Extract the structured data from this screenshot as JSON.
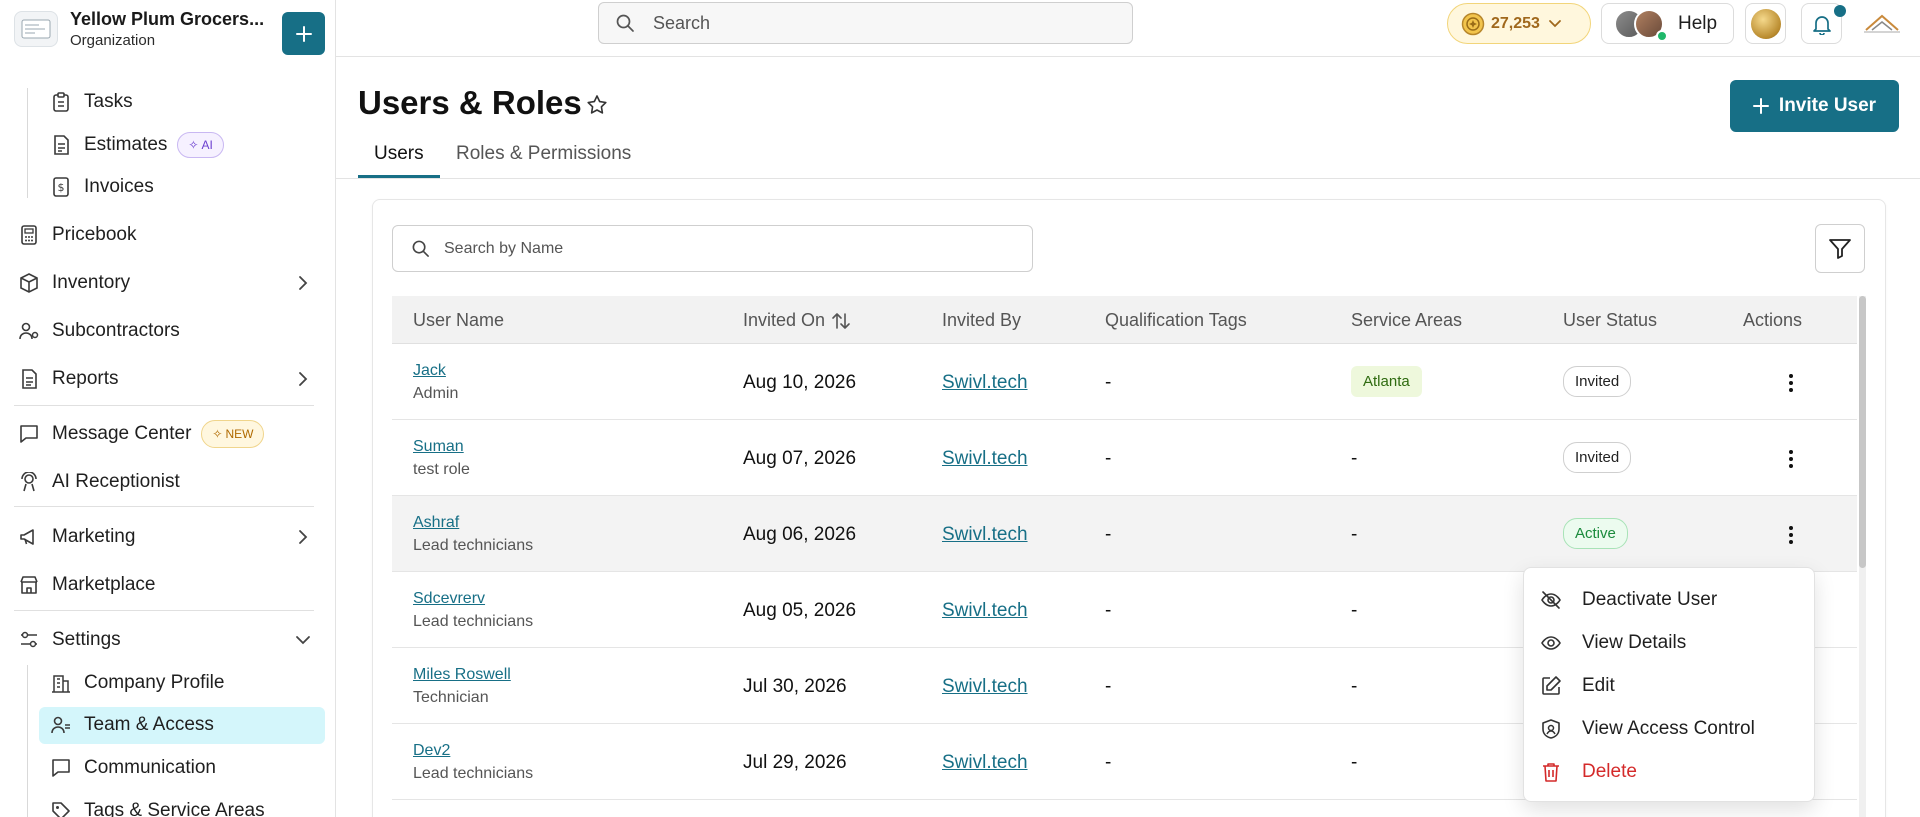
{
  "org": {
    "name": "Yellow Plum Grocers...",
    "type": "Organization"
  },
  "sidebar": {
    "project_items": [
      {
        "label": "Tasks",
        "icon": "clipboard-icon"
      },
      {
        "label": "Estimates",
        "icon": "estimate-icon",
        "badge": "AI"
      },
      {
        "label": "Invoices",
        "icon": "invoice-icon"
      }
    ],
    "items": [
      {
        "label": "Pricebook",
        "icon": "calculator-icon"
      },
      {
        "label": "Inventory",
        "icon": "box-icon",
        "expandable": true
      },
      {
        "label": "Subcontractors",
        "icon": "user-link-icon"
      },
      {
        "label": "Reports",
        "icon": "report-icon",
        "expandable": true
      },
      {
        "label": "Message Center",
        "icon": "message-icon",
        "badge": "NEW"
      },
      {
        "label": "AI Receptionist",
        "icon": "receptionist-icon"
      },
      {
        "label": "Marketing",
        "icon": "megaphone-icon",
        "expandable": true
      },
      {
        "label": "Marketplace",
        "icon": "store-icon"
      },
      {
        "label": "Settings",
        "icon": "settings-icon",
        "expanded": true
      }
    ],
    "settings_items": [
      {
        "label": "Company Profile",
        "icon": "building-icon"
      },
      {
        "label": "Team & Access",
        "icon": "team-icon",
        "active": true
      },
      {
        "label": "Communication",
        "icon": "chat-icon"
      },
      {
        "label": "Tags & Service Areas",
        "icon": "tag-icon"
      }
    ]
  },
  "topbar": {
    "search_placeholder": "Search",
    "coins": "27,253",
    "help_label": "Help"
  },
  "page": {
    "title": "Users & Roles",
    "invite_button": "Invite User",
    "tabs": [
      {
        "label": "Users",
        "active": true
      },
      {
        "label": "Roles & Permissions",
        "active": false
      }
    ]
  },
  "table": {
    "search_placeholder": "Search by Name",
    "columns": [
      "User Name",
      "Invited On",
      "Invited By",
      "Qualification Tags",
      "Service Areas",
      "User Status",
      "Actions"
    ],
    "rows": [
      {
        "name": "Jack",
        "role": "Admin",
        "invited_on": "Aug 10, 2026",
        "invited_by": "Swivl.tech",
        "tags": "-",
        "areas": "Atlanta",
        "status": "Invited"
      },
      {
        "name": "Suman",
        "role": "test role",
        "invited_on": "Aug 07, 2026",
        "invited_by": "Swivl.tech",
        "tags": "-",
        "areas": "-",
        "status": "Invited"
      },
      {
        "name": "Ashraf",
        "role": "Lead technicians",
        "invited_on": "Aug 06, 2026",
        "invited_by": "Swivl.tech",
        "tags": "-",
        "areas": "-",
        "status": "Active"
      },
      {
        "name": "Sdcevrerv",
        "role": "Lead technicians",
        "invited_on": "Aug 05, 2026",
        "invited_by": "Swivl.tech",
        "tags": "-",
        "areas": "-",
        "status": ""
      },
      {
        "name": "Miles Roswell",
        "role": "Technician",
        "invited_on": "Jul 30, 2026",
        "invited_by": "Swivl.tech",
        "tags": "-",
        "areas": "-",
        "status": ""
      },
      {
        "name": "Dev2",
        "role": "Lead technicians",
        "invited_on": "Jul 29, 2026",
        "invited_by": "Swivl.tech",
        "tags": "-",
        "areas": "-",
        "status": ""
      }
    ]
  },
  "actions_menu": {
    "items": [
      {
        "label": "Deactivate User",
        "icon": "eye-off-icon"
      },
      {
        "label": "View Details",
        "icon": "eye-icon"
      },
      {
        "label": "Edit",
        "icon": "edit-icon"
      },
      {
        "label": "View Access Control",
        "icon": "shield-icon"
      },
      {
        "label": "Delete",
        "icon": "trash-icon",
        "danger": true
      }
    ]
  },
  "colors": {
    "primary": "#176f86",
    "active_nav": "#d4f6fb",
    "danger": "#d42a2a",
    "active_status": "#1a8a3c"
  }
}
